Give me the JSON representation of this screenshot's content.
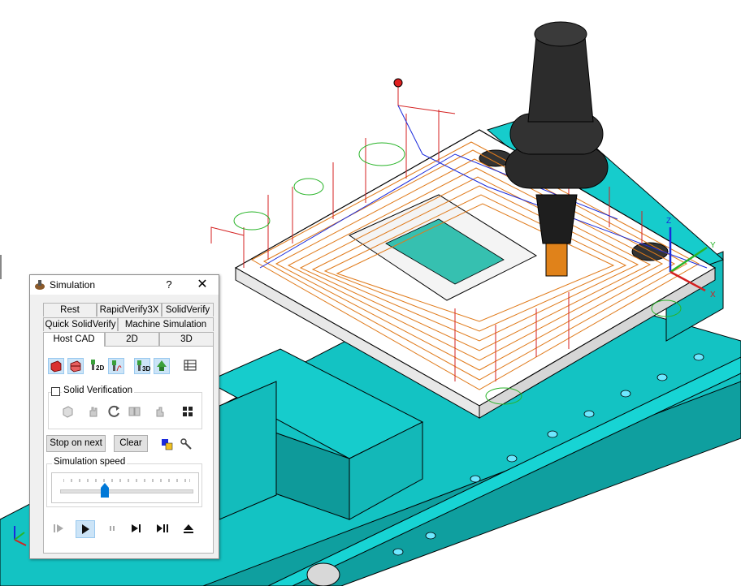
{
  "dialog": {
    "title": "Simulation",
    "help": "?",
    "close": "✕",
    "tabs_row1": [
      "Rest Material",
      "RapidVerify3X",
      "SolidVerify"
    ],
    "tabs_row2": [
      "Quick SolidVerify",
      "Machine Simulation"
    ],
    "tabs_row3": [
      "Host CAD",
      "2D",
      "3D"
    ],
    "active_tab": "Host CAD",
    "toolbar_icons": [
      "stock-solid-icon",
      "stock-wire-icon",
      "tool-2d-icon",
      "toolpath-icon",
      "tool-3d-icon",
      "holder-icon",
      "list-view-icon"
    ],
    "solid_verification": {
      "label": "Solid Verification",
      "checked": false
    },
    "verify_icons": [
      "cube-icon",
      "hand-icon",
      "reset-icon",
      "compare-icon",
      "pointer-icon",
      "fit-icon"
    ],
    "stop_on_next": "Stop on next",
    "clear": "Clear",
    "speed": {
      "label": "Simulation speed",
      "value_fraction": 0.34
    },
    "playback_icons": [
      "step-back-icon",
      "play-icon",
      "pause-icon",
      "step-next-icon",
      "step-forward-icon",
      "eject-icon"
    ]
  },
  "scene": {
    "axis_labels": {
      "x": "X",
      "y": "Y",
      "z": "Z"
    },
    "colors": {
      "vise": "#14c8c8",
      "vise_dark": "#0a8f8f",
      "toolpath_orange": "#e07a1a",
      "toolpath_red": "#d42020",
      "toolpath_green": "#28b428",
      "rapid_blue": "#1a2adc",
      "holder": "#2a2a2a",
      "tool": "#e0821a"
    }
  }
}
